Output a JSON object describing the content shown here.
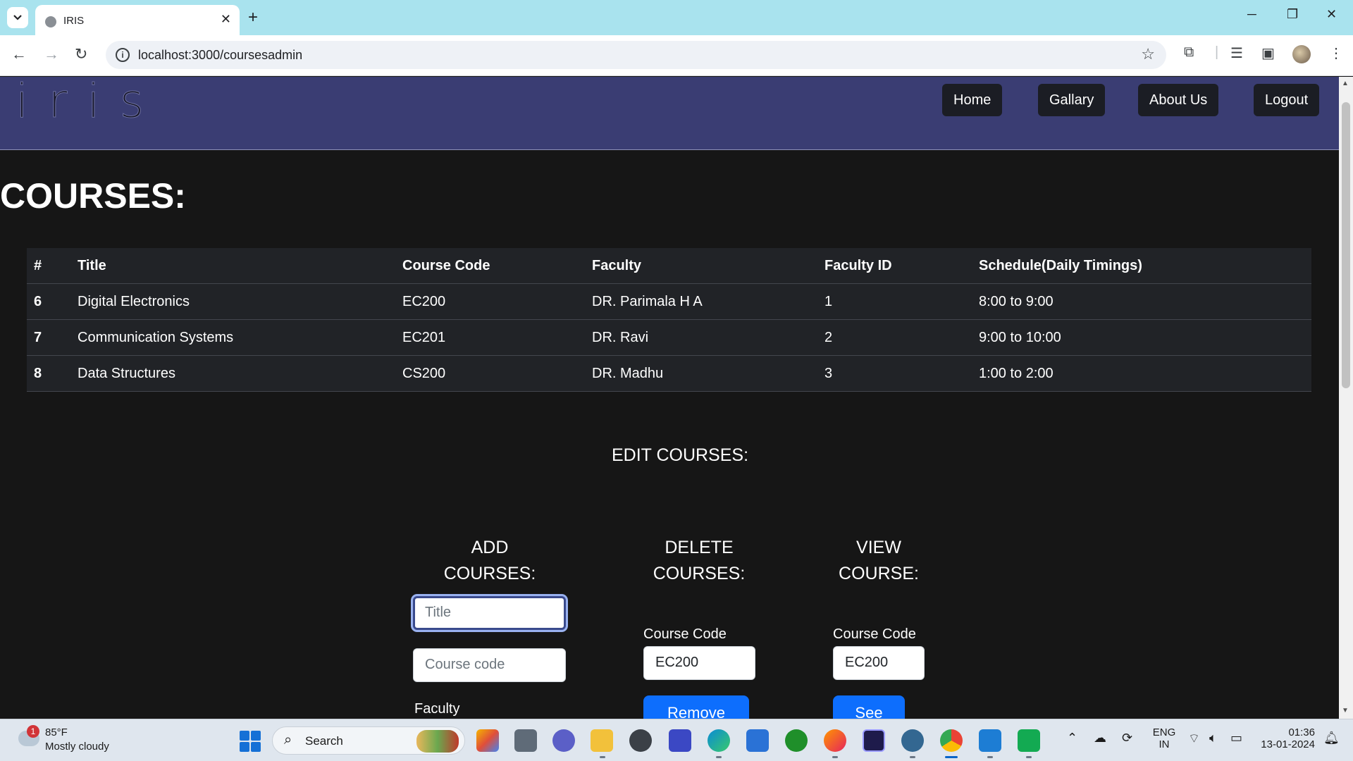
{
  "browser": {
    "tab_title": "IRIS",
    "url": "localhost:3000/coursesadmin"
  },
  "site": {
    "logo_text": "iris",
    "nav": [
      "Home",
      "Gallary",
      "About Us",
      "Logout"
    ]
  },
  "page": {
    "heading": "COURSES:",
    "table": {
      "headers": [
        "#",
        "Title",
        "Course Code",
        "Faculty",
        "Faculty ID",
        "Schedule(Daily Timings)"
      ],
      "rows": [
        [
          "6",
          "Digital Electronics",
          "EC200",
          "DR. Parimala H A",
          "1",
          "8:00 to 9:00"
        ],
        [
          "7",
          "Communication Systems",
          "EC201",
          "DR. Ravi",
          "2",
          "9:00 to 10:00"
        ],
        [
          "8",
          "Data Structures",
          "CS200",
          "DR. Madhu",
          "3",
          "1:00 to 2:00"
        ]
      ]
    },
    "edit_title": "EDIT COURSES:",
    "add": {
      "title": "ADD COURSES:",
      "title_placeholder": "Title",
      "code_placeholder": "Course code",
      "faculty_label": "Faculty"
    },
    "delete": {
      "title_line1": "DELETE",
      "title_line2": "COURSES:",
      "code_label": "Course Code",
      "code_value": "EC200",
      "button": "Remove"
    },
    "view": {
      "title_line1": "VIEW",
      "title_line2": "COURSE:",
      "code_label": "Course Code",
      "code_value": "EC200",
      "button": "See"
    }
  },
  "taskbar": {
    "weather_badge": "1",
    "weather_temp": "85°F",
    "weather_desc": "Mostly cloudy",
    "search_label": "Search",
    "lang_line1": "ENG",
    "lang_line2": "IN",
    "time": "01:36",
    "date": "13-01-2024"
  },
  "colors": {
    "site_nav_bg": "#3a3d73",
    "page_bg": "#161616",
    "table_bg": "#212327",
    "primary_button": "#0d6efd"
  }
}
